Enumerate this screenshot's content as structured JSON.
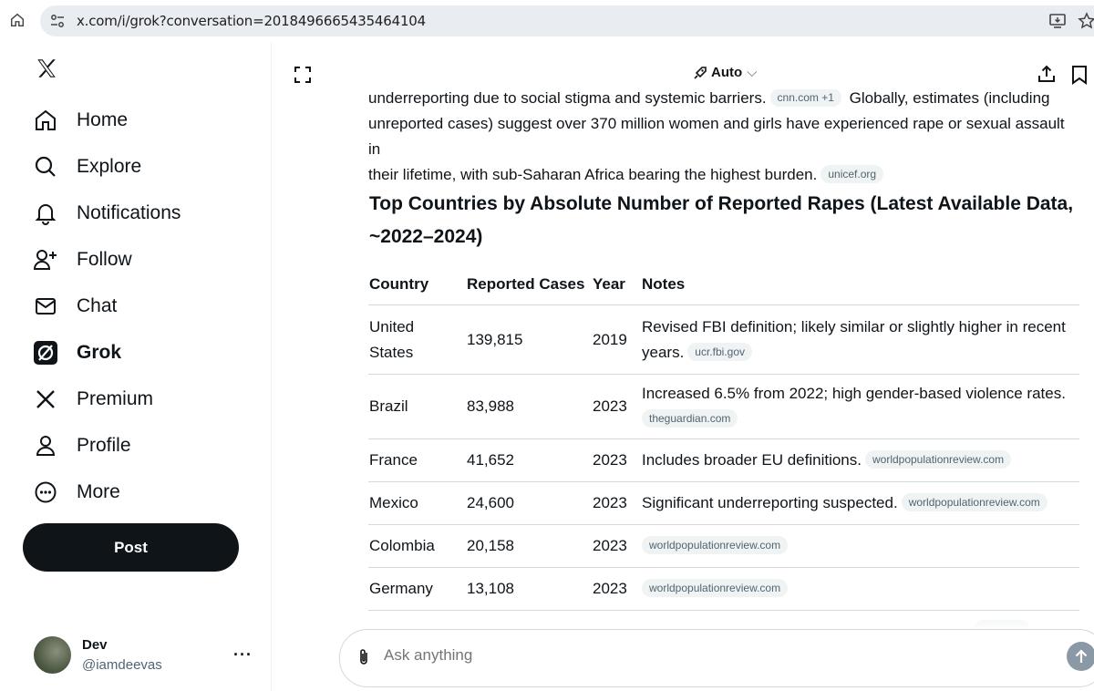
{
  "browser": {
    "url": "x.com/i/grok?conversation=2018496665435464104"
  },
  "sidebar": {
    "items": [
      {
        "label": "Home",
        "icon": "home-icon"
      },
      {
        "label": "Explore",
        "icon": "search-icon"
      },
      {
        "label": "Notifications",
        "icon": "bell-icon"
      },
      {
        "label": "Follow",
        "icon": "follow-icon"
      },
      {
        "label": "Chat",
        "icon": "mail-icon"
      },
      {
        "label": "Grok",
        "icon": "grok-icon",
        "active": true
      },
      {
        "label": "Premium",
        "icon": "x-logo-icon"
      },
      {
        "label": "Profile",
        "icon": "person-icon"
      },
      {
        "label": "More",
        "icon": "more-circle-icon"
      }
    ],
    "post_label": "Post",
    "account": {
      "name": "Dev",
      "handle": "@iamdeevas",
      "more": "···"
    }
  },
  "header": {
    "mode": "Auto"
  },
  "response": {
    "para_line1_text": "underreporting due to social stigma and systemic barriers.",
    "para_line1_chip": "cnn.com +1",
    "para_line1_tail": "Globally, estimates (including",
    "para_line2": "unreported cases) suggest over 370 million women and girls have experienced rape or sexual assault in",
    "para_line3": "their lifetime, with sub-Saharan Africa bearing the highest burden.",
    "para_line3_chip": "unicef.org",
    "heading": "Top Countries by Absolute Number of Reported Rapes (Latest Available Data, ~2022–2024)",
    "table": {
      "headers": [
        "Country",
        "Reported Cases",
        "Year",
        "Notes"
      ],
      "rows": [
        {
          "country": "United States",
          "cases": "139,815",
          "year": "2019",
          "note": "Revised FBI definition; likely similar or slightly higher in recent years.",
          "chip": "ucr.fbi.gov"
        },
        {
          "country": "Brazil",
          "cases": "83,988",
          "year": "2023",
          "note": "Increased 6.5% from 2022; high gender-based violence rates.",
          "chip": "theguardian.com"
        },
        {
          "country": "France",
          "cases": "41,652",
          "year": "2023",
          "note": "Includes broader EU definitions.",
          "chip": "worldpopulationreview.com"
        },
        {
          "country": "Mexico",
          "cases": "24,600",
          "year": "2023",
          "note": "Significant underreporting suspected.",
          "chip": "worldpopulationreview.com"
        },
        {
          "country": "Colombia",
          "cases": "20,158",
          "year": "2023",
          "note": "",
          "chip": "worldpopulationreview.com"
        },
        {
          "country": "Germany",
          "cases": "13,108",
          "year": "2023",
          "note": "",
          "chip": "worldpopulationreview.com"
        }
      ]
    }
  },
  "composer": {
    "placeholder": "Ask anything"
  }
}
